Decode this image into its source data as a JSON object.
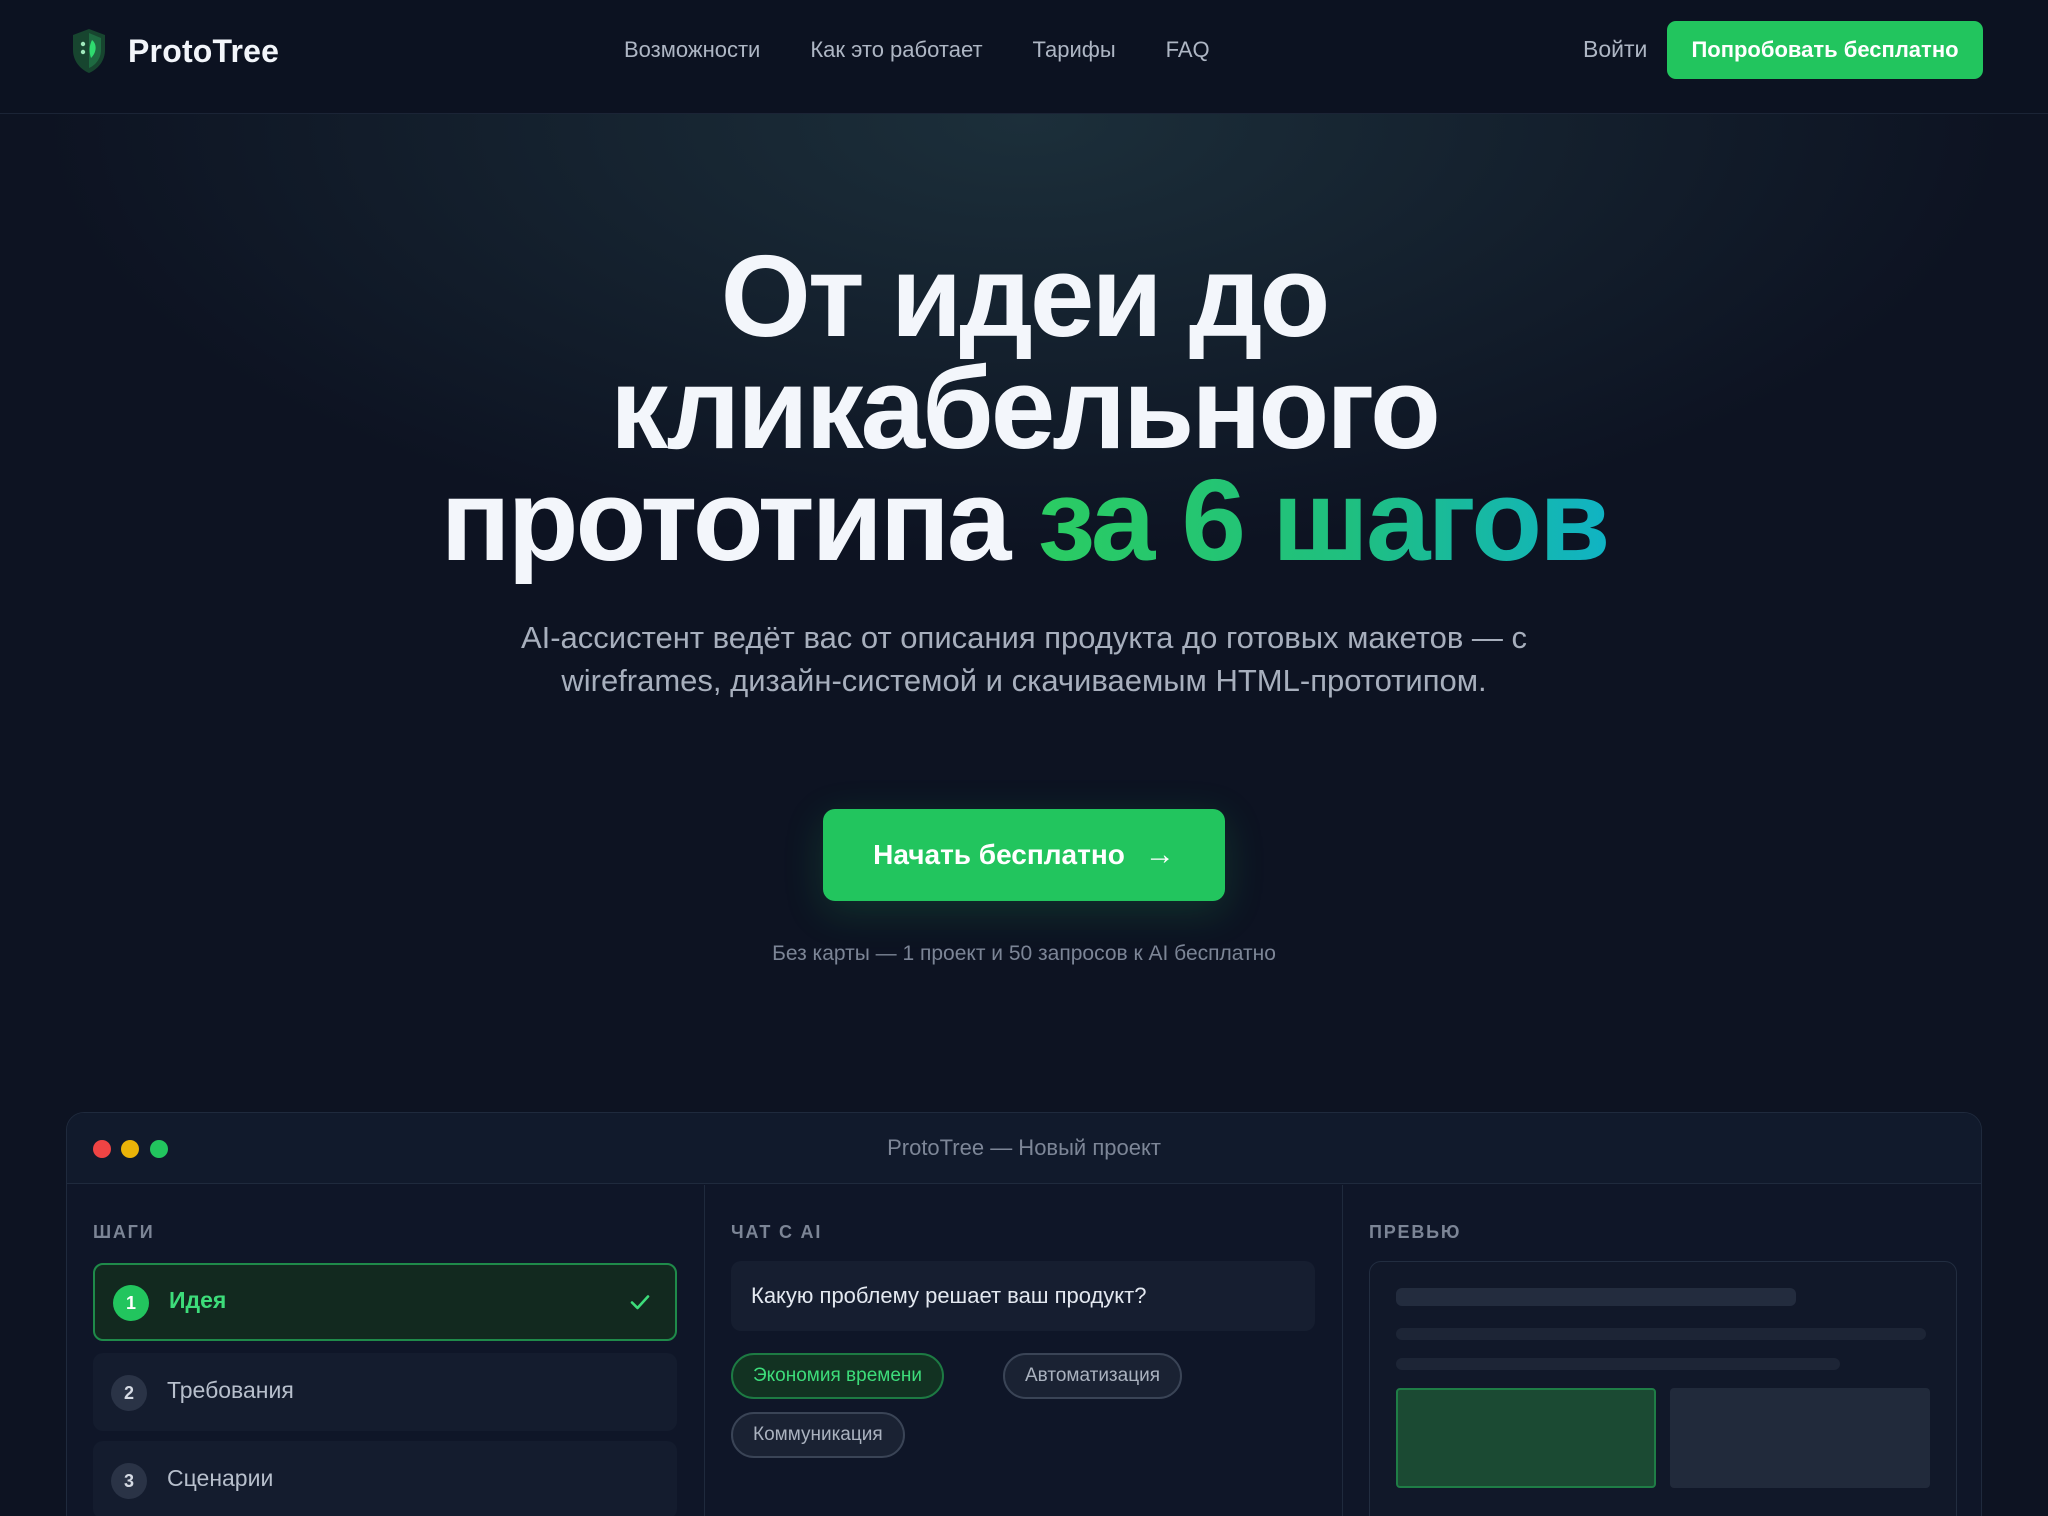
{
  "brand": {
    "name": "ProtoTree",
    "icon": "shield-leaf-icon",
    "accent": "#22c55e"
  },
  "nav": {
    "links": [
      "Возможности",
      "Как это работает",
      "Тарифы",
      "FAQ"
    ],
    "login": "Войти",
    "cta": "Попробовать бесплатно"
  },
  "hero": {
    "title_line1": "От идеи до",
    "title_line2": "кликабельного",
    "title_line3_plain": "прототипа",
    "title_line3_accent": "за 6 шагов",
    "subtitle": "AI-ассистент ведёт вас от описания продукта до готовых макетов — с wireframes, дизайн-системой и скачиваемым HTML-прототипом.",
    "cta": "Начать бесплатно",
    "cta_icon": "arrow-right-icon",
    "note": "Без карты — 1 проект и 50 запросов к AI бесплатно"
  },
  "window": {
    "title": "ProtoTree — Новый проект",
    "steps": {
      "label": "ШАГИ",
      "items": [
        {
          "num": "1",
          "label": "Идея",
          "state": "done"
        },
        {
          "num": "2",
          "label": "Требования",
          "state": "todo"
        },
        {
          "num": "3",
          "label": "Сценарии",
          "state": "todo"
        }
      ]
    },
    "chat": {
      "label": "ЧАТ С AI",
      "question": "Какую проблему решает ваш продукт?",
      "chips": [
        {
          "label": "Экономия времени",
          "selected": true
        },
        {
          "label": "Автоматизация",
          "selected": false
        },
        {
          "label": "Коммуникация",
          "selected": false
        }
      ]
    },
    "preview": {
      "label": "ПРЕВЬЮ"
    }
  }
}
